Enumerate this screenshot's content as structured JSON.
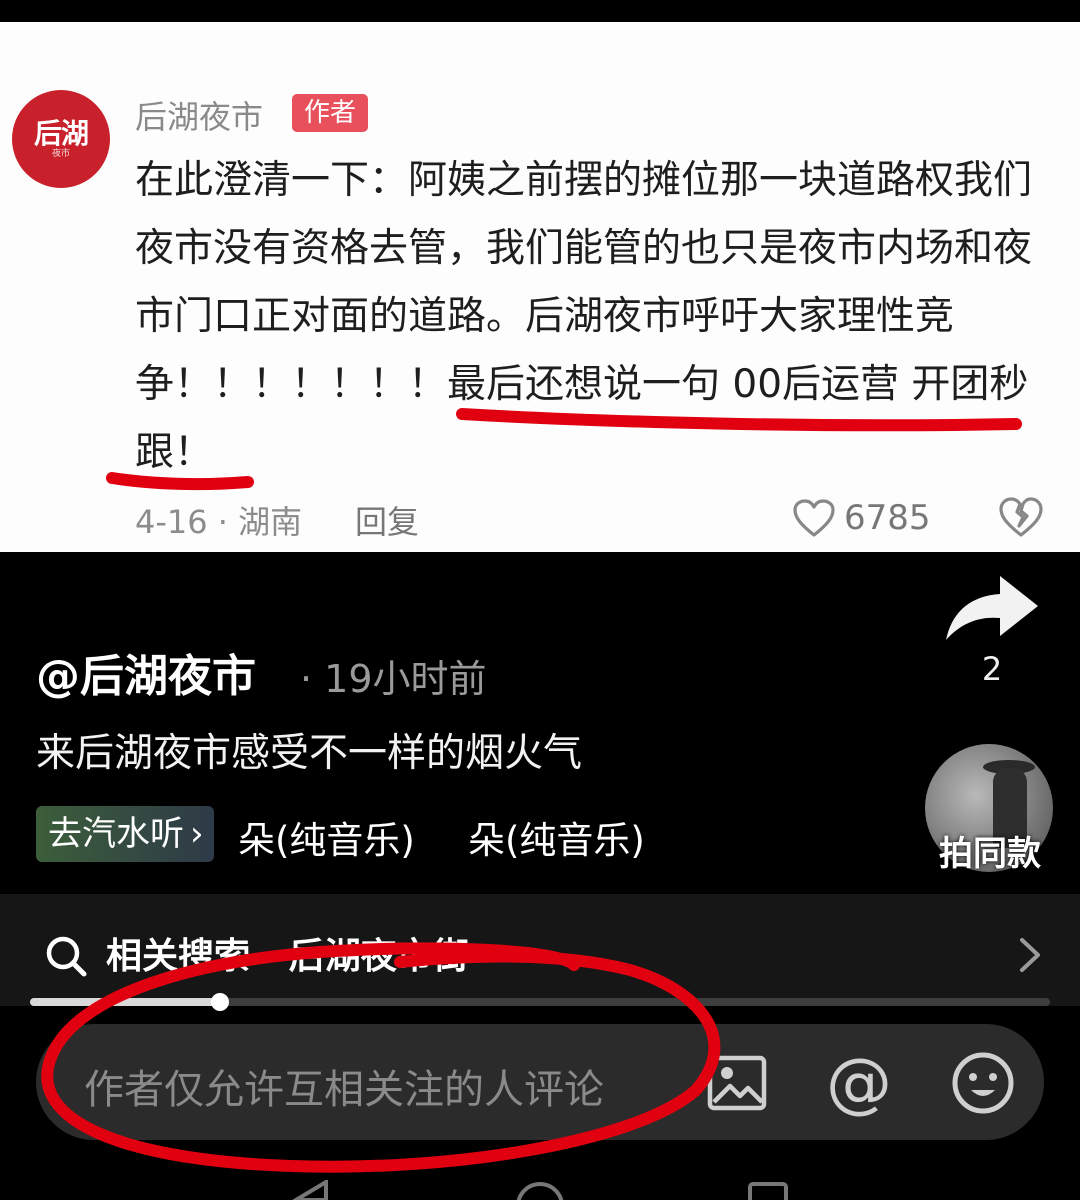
{
  "comment": {
    "author_name": "后湖夜市",
    "author_badge": "作者",
    "avatar_logo": "后湖",
    "avatar_logo_sub": "夜市",
    "text": "在此澄清一下：阿姨之前摆的摊位那一块道路权我们夜市没有资格去管，我们能管的也只是夜市内场和夜市门口正对面的道路。后湖夜市呼吁大家理性竞争！！！！！！！最后还想说一句 00后运营 开团秒跟！",
    "meta": "4-16 · 湖南",
    "reply_label": "回复",
    "like_count": "6785"
  },
  "video": {
    "share_count": "2",
    "author": "@后湖夜市",
    "time": "· 19小时前",
    "description": "来后湖夜市感受不一样的烟火气",
    "music_chip": "去汽水听",
    "music_title_1": "朵(纯音乐)",
    "music_title_2": "朵(纯音乐)",
    "same_style_label": "拍同款",
    "progress": 0.186
  },
  "related_search": {
    "text": "相关搜索 · 后湖夜市街"
  },
  "comment_input": {
    "placeholder": "作者仅允许互相关注的人评论"
  },
  "colors": {
    "author_badge": "#e8505b",
    "avatar": "#c8212b",
    "annotation_red": "#e0000f"
  }
}
